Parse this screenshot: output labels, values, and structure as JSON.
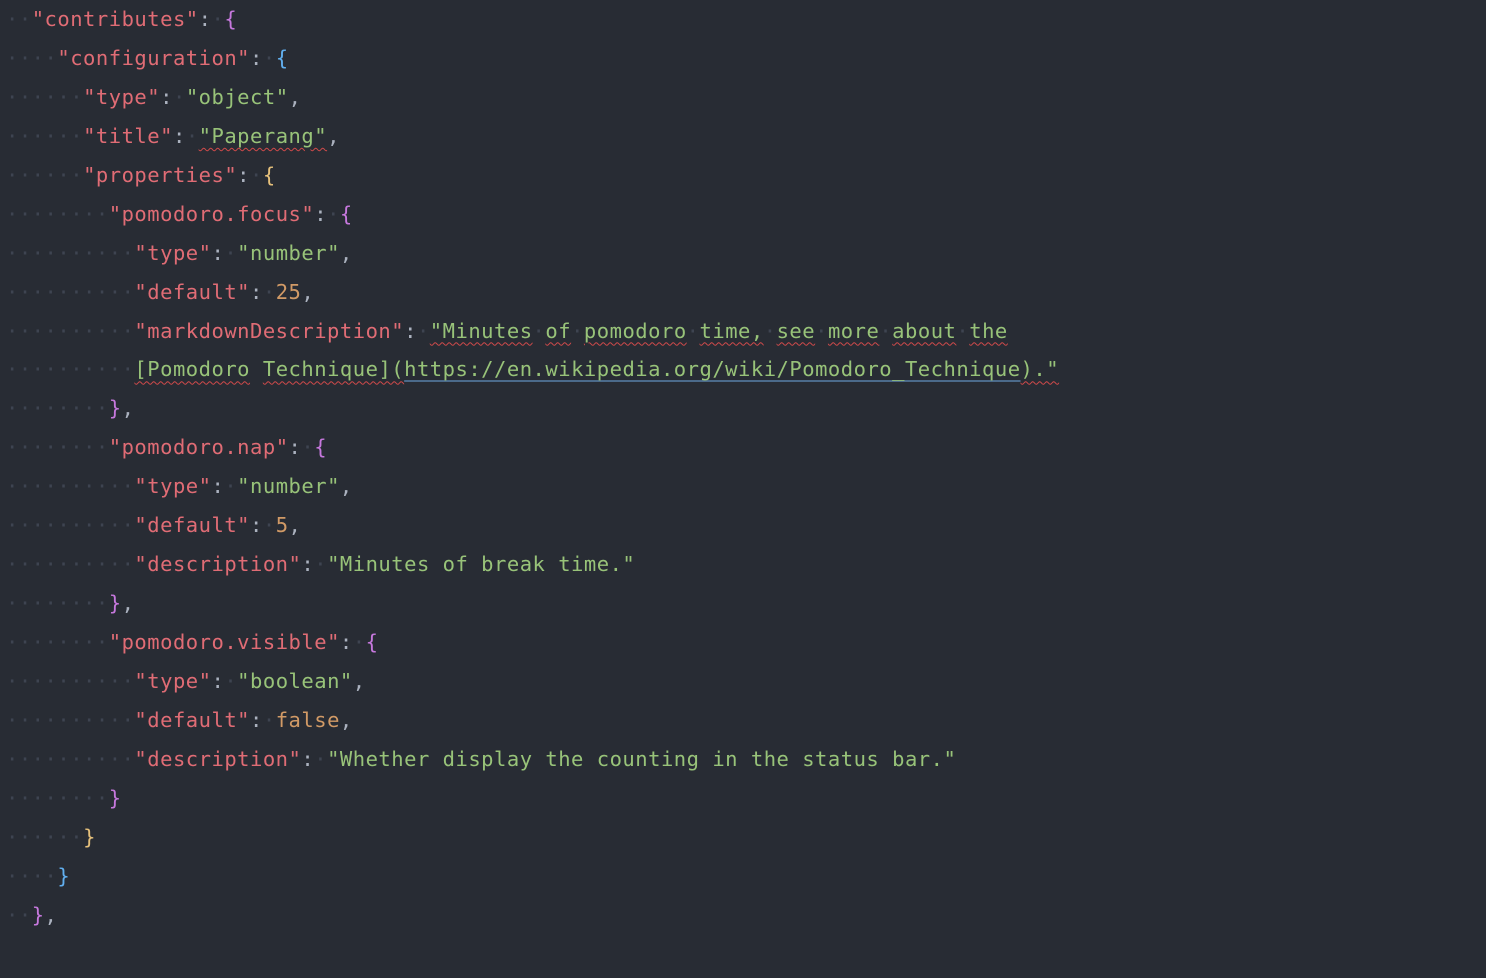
{
  "ws": "····",
  "keys": {
    "contributes": "\"contributes\"",
    "configuration": "\"configuration\"",
    "type": "\"type\"",
    "title": "\"title\"",
    "properties": "\"properties\"",
    "pomodoroFocus": "\"pomodoro.focus\"",
    "default": "\"default\"",
    "markdownDescription": "\"markdownDescription\"",
    "pomodoroNap": "\"pomodoro.nap\"",
    "description": "\"description\"",
    "pomodoroVisible": "\"pomodoro.visible\""
  },
  "vals": {
    "object": "\"object\"",
    "paperang": "\"Paperang\"",
    "number": "\"number\"",
    "twentyfive": "25",
    "mdDesc_a": "\"Minutes",
    "mdDesc_b": "of",
    "mdDesc_c": "pomodoro",
    "mdDesc_d": "time,",
    "mdDesc_e": "see",
    "mdDesc_f": "more",
    "mdDesc_g": "about",
    "mdDesc_h": "the",
    "mdDesc_i": "[Pomodoro",
    "mdDesc_j": "Technique](",
    "mdDesc_url": "https://en.wikipedia.org/wiki/Pomodoro_Technique",
    "mdDesc_k": ").\"",
    "five": "5",
    "napDesc": "\"Minutes of break time.\"",
    "boolean": "\"boolean\"",
    "false": "false",
    "visDesc": "\"Whether display the counting in the status bar.\""
  },
  "pun": {
    "colon": ":",
    "comma": ",",
    "openBrace": "{",
    "closeBrace": "}"
  }
}
